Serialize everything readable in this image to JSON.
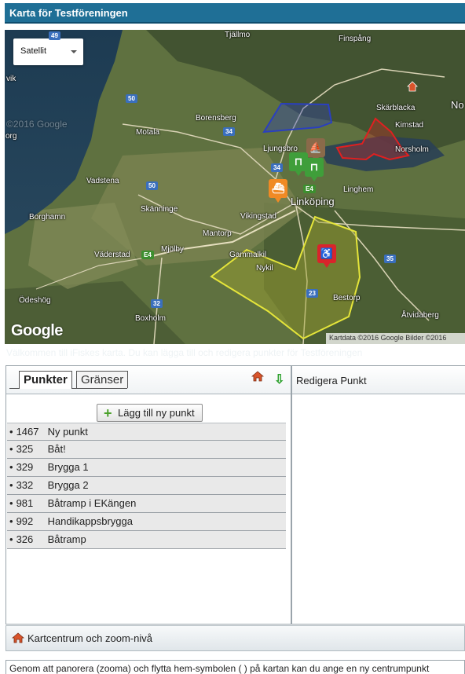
{
  "header": {
    "title": "Karta för Testföreningen"
  },
  "map": {
    "maptype_label": "Satellit",
    "google_logo": "Google",
    "attribution": "Kartdata ©2016 Google Bilder ©2016",
    "watermark": "©2016 Google",
    "places": {
      "tjallmo": "Tjällmo",
      "finspang": "Finspång",
      "borensberg": "Borensberg",
      "motala": "Motala",
      "ljungsbro": "Ljungsbro",
      "skarblacka": "Skärblacka",
      "kimstad": "Kimstad",
      "norsholm": "Norsholm",
      "vadstena": "Vadstena",
      "linghem": "Linghem",
      "linkoping": "Linköping",
      "borghamn": "Borghamn",
      "skanninge": "Skänninge",
      "vikingstad": "Vikingstad",
      "mantorp": "Mantorp",
      "vaderstad": "Väderstad",
      "mjolby": "Mjölby",
      "gammalkil": "Gammalkil",
      "nykil": "Nykil",
      "odeshog": "Ödeshög",
      "boxholm": "Boxholm",
      "bestorp": "Bestorp",
      "atvidaberg": "Åtvidaberg",
      "vik": "vik",
      "org": "org",
      "no": "No"
    },
    "shields": {
      "r50a": "50",
      "r50b": "50",
      "r34a": "34",
      "r34b": "34",
      "e4a": "E4",
      "e4b": "E4",
      "r35": "35",
      "r23": "23",
      "r32": "32",
      "r49": "49"
    }
  },
  "welcome_text": "Välkommen till iFiskes karta. Du kan lägga till och redigera punkter för Testföreningen",
  "left_panel": {
    "tabs": [
      "Punkter",
      "Gränser"
    ],
    "add_button": "Lägg till ny punkt",
    "points": [
      {
        "id": "1467",
        "name": "Ny punkt"
      },
      {
        "id": "325",
        "name": "Båt!"
      },
      {
        "id": "329",
        "name": "Brygga 1"
      },
      {
        "id": "332",
        "name": "Brygga 2"
      },
      {
        "id": "981",
        "name": "Båtramp i EKängen"
      },
      {
        "id": "992",
        "name": "Handikappsbrygga"
      },
      {
        "id": "326",
        "name": "Båtramp"
      }
    ]
  },
  "right_panel": {
    "title": "Redigera Punkt"
  },
  "center_bar": {
    "label": "Kartcentrum och zoom-nivå"
  },
  "bottom_text": "Genom att panorera (zooma) och flytta hem-symbolen (    ) på kartan kan du ange en ny centrumpunkt",
  "icons": {
    "home": "home-icon",
    "down_arrow": "arrow-down-icon",
    "plus": "plus-icon",
    "boat": "boat-icon",
    "bridge": "bridge-icon",
    "ramp": "boat-ramp-icon",
    "wheelchair": "wheelchair-icon"
  },
  "colors": {
    "header_bg": "#1f6f96",
    "zone_yellow": "#e5e53a",
    "zone_blue": "#2a3fc0",
    "zone_red": "#e02020",
    "marker_green": "#3f9e3a",
    "marker_orange": "#f08a24",
    "marker_brown": "#8a6a4a",
    "marker_red": "#d9242b"
  }
}
